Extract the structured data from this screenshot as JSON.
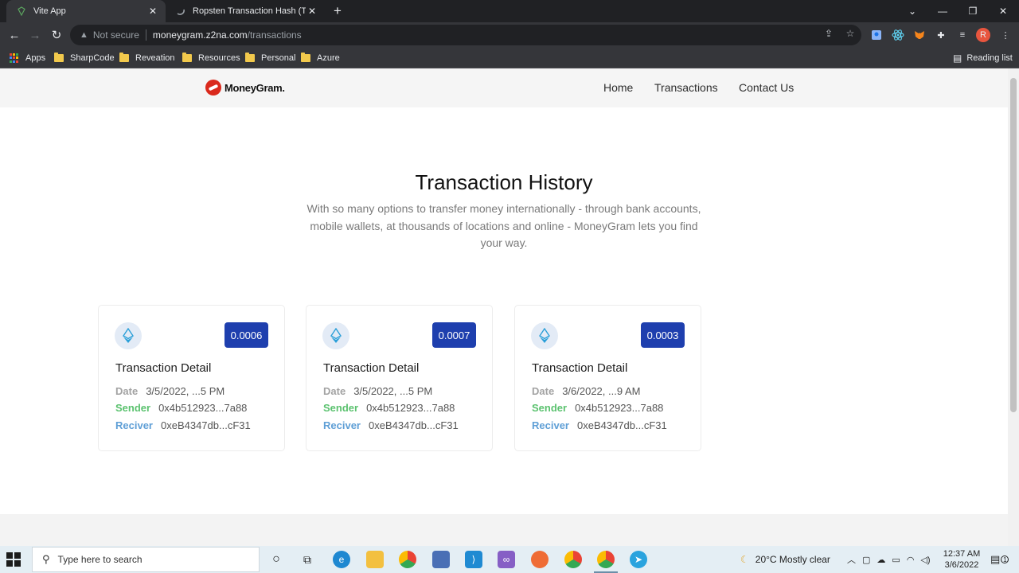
{
  "browser": {
    "tabs": [
      {
        "title": "Vite App",
        "active": true
      },
      {
        "title": "Ropsten Transaction Hash (Txhash)",
        "active": false
      }
    ],
    "url": {
      "security_label": "Not secure",
      "host": "moneygram.z2na.com",
      "path": "/transactions"
    },
    "bookmarks": [
      "Apps",
      "SharpCode",
      "Reveation",
      "Resources",
      "Personal",
      "Azure"
    ],
    "reading_list_label": "Reading list",
    "profile_initial": "R"
  },
  "site": {
    "logo_text": "MoneyGram.",
    "nav": [
      "Home",
      "Transactions",
      "Contact Us"
    ]
  },
  "hero": {
    "title": "Transaction History",
    "subtitle": "With so many options to transfer money internationally - through bank accounts, mobile wallets, at thousands of locations and online - MoneyGram lets you find your way."
  },
  "labels": {
    "card_title": "Transaction Detail",
    "date": "Date",
    "sender": "Sender",
    "receiver": "Reciver"
  },
  "transactions": [
    {
      "amount": "0.0006",
      "date": "3/5/2022, ...5 PM",
      "sender": "0x4b512923...7a88",
      "receiver": "0xeB4347db...cF31"
    },
    {
      "amount": "0.0007",
      "date": "3/5/2022, ...5 PM",
      "sender": "0x4b512923...7a88",
      "receiver": "0xeB4347db...cF31"
    },
    {
      "amount": "0.0003",
      "date": "3/6/2022, ...9 AM",
      "sender": "0x4b512923...7a88",
      "receiver": "0xeB4347db...cF31"
    }
  ],
  "taskbar": {
    "search_placeholder": "Type here to search",
    "weather": "20°C  Mostly clear",
    "time": "12:37 AM",
    "date": "3/6/2022",
    "notification_count": "1"
  },
  "colors": {
    "amount_badge": "#1e3fae",
    "sender_label": "#5bc26f",
    "receiver_label": "#5f9fd6",
    "brand_red": "#da291c"
  }
}
